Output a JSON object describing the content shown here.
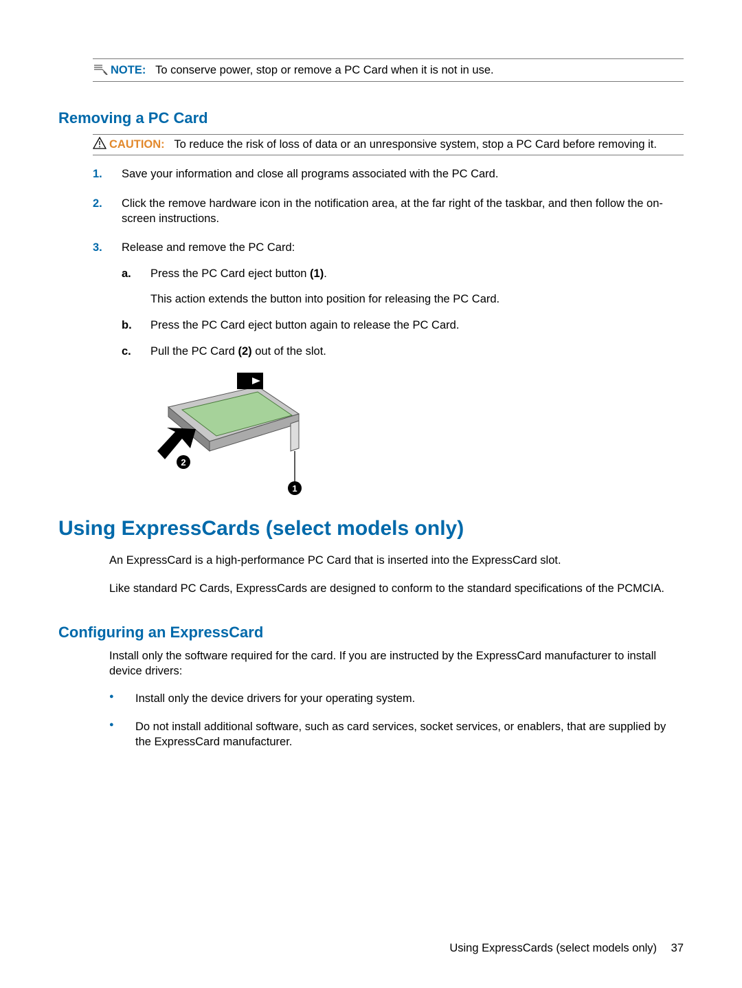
{
  "note": {
    "label": "NOTE:",
    "text": "To conserve power, stop or remove a PC Card when it is not in use."
  },
  "section1": {
    "heading": "Removing a PC Card",
    "caution": {
      "label": "CAUTION:",
      "text": "To reduce the risk of loss of data or an unresponsive system, stop a PC Card before removing it."
    },
    "steps": {
      "s1": {
        "num": "1.",
        "text": "Save your information and close all programs associated with the PC Card."
      },
      "s2": {
        "num": "2.",
        "text": "Click the remove hardware icon in the notification area, at the far right of the taskbar, and then follow the on-screen instructions."
      },
      "s3": {
        "num": "3.",
        "text": "Release and remove the PC Card:",
        "sub": {
          "a": {
            "alpha": "a.",
            "pre": "Press the PC Card eject button ",
            "bold": "(1)",
            "post": ".",
            "note": "This action extends the button into position for releasing the PC Card."
          },
          "b": {
            "alpha": "b.",
            "text": "Press the PC Card eject button again to release the PC Card."
          },
          "c": {
            "alpha": "c.",
            "pre": "Pull the PC Card ",
            "bold": "(2)",
            "post": " out of the slot."
          }
        }
      }
    }
  },
  "major": {
    "heading": "Using ExpressCards (select models only)",
    "p1": "An ExpressCard is a high-performance PC Card that is inserted into the ExpressCard slot.",
    "p2": "Like standard PC Cards, ExpressCards are designed to conform to the standard specifications of the PCMCIA."
  },
  "section2": {
    "heading": "Configuring an ExpressCard",
    "intro": "Install only the software required for the card. If you are instructed by the ExpressCard manufacturer to install device drivers:",
    "bullets": {
      "b1": "Install only the device drivers for your operating system.",
      "b2": "Do not install additional software, such as card services, socket services, or enablers, that are supplied by the ExpressCard manufacturer."
    }
  },
  "footer": {
    "text": "Using ExpressCards (select models only)",
    "page": "37"
  }
}
